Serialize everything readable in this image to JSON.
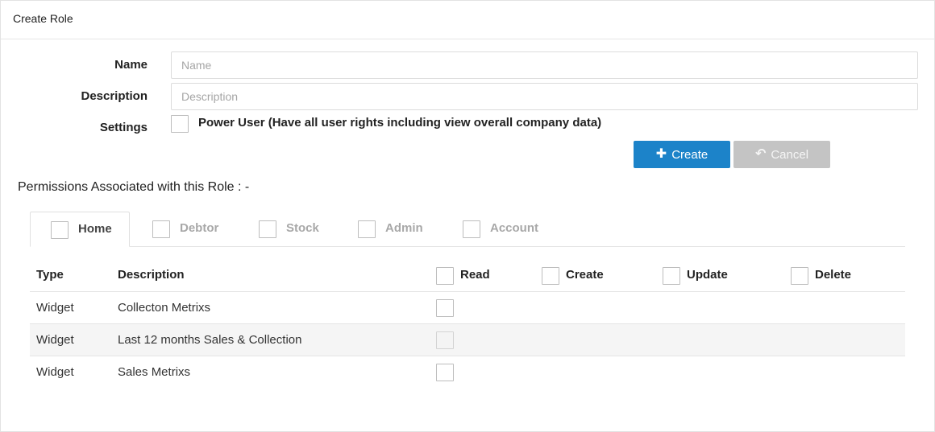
{
  "header": {
    "title": "Create Role"
  },
  "form": {
    "name_label": "Name",
    "name_placeholder": "Name",
    "name_value": "",
    "description_label": "Description",
    "description_placeholder": "Description",
    "description_value": "",
    "settings_label": "Settings",
    "power_user_label": "Power User (Have all user rights including view overall company data)",
    "power_user_checked": false
  },
  "buttons": {
    "create_label": "Create",
    "create_icon": "plus-icon",
    "cancel_label": "Cancel",
    "cancel_icon": "undo-arrow-icon"
  },
  "permissions": {
    "title": "Permissions Associated with this Role : -",
    "tabs": [
      {
        "label": "Home",
        "active": true
      },
      {
        "label": "Debtor",
        "active": false
      },
      {
        "label": "Stock",
        "active": false
      },
      {
        "label": "Admin",
        "active": false
      },
      {
        "label": "Account",
        "active": false
      }
    ],
    "columns": {
      "type": "Type",
      "description": "Description",
      "read": "Read",
      "create": "Create",
      "update": "Update",
      "delete": "Delete"
    },
    "rows": [
      {
        "type": "Widget",
        "description": "Collecton Metrixs",
        "read_checked": false
      },
      {
        "type": "Widget",
        "description": "Last 12 months Sales & Collection",
        "read_checked": false
      },
      {
        "type": "Widget",
        "description": "Sales Metrixs",
        "read_checked": false
      }
    ]
  },
  "colors": {
    "primary": "#1c83c9",
    "disabled": "#c4c4c4",
    "border": "#e4e4e4",
    "stripe": "#f5f5f5"
  }
}
